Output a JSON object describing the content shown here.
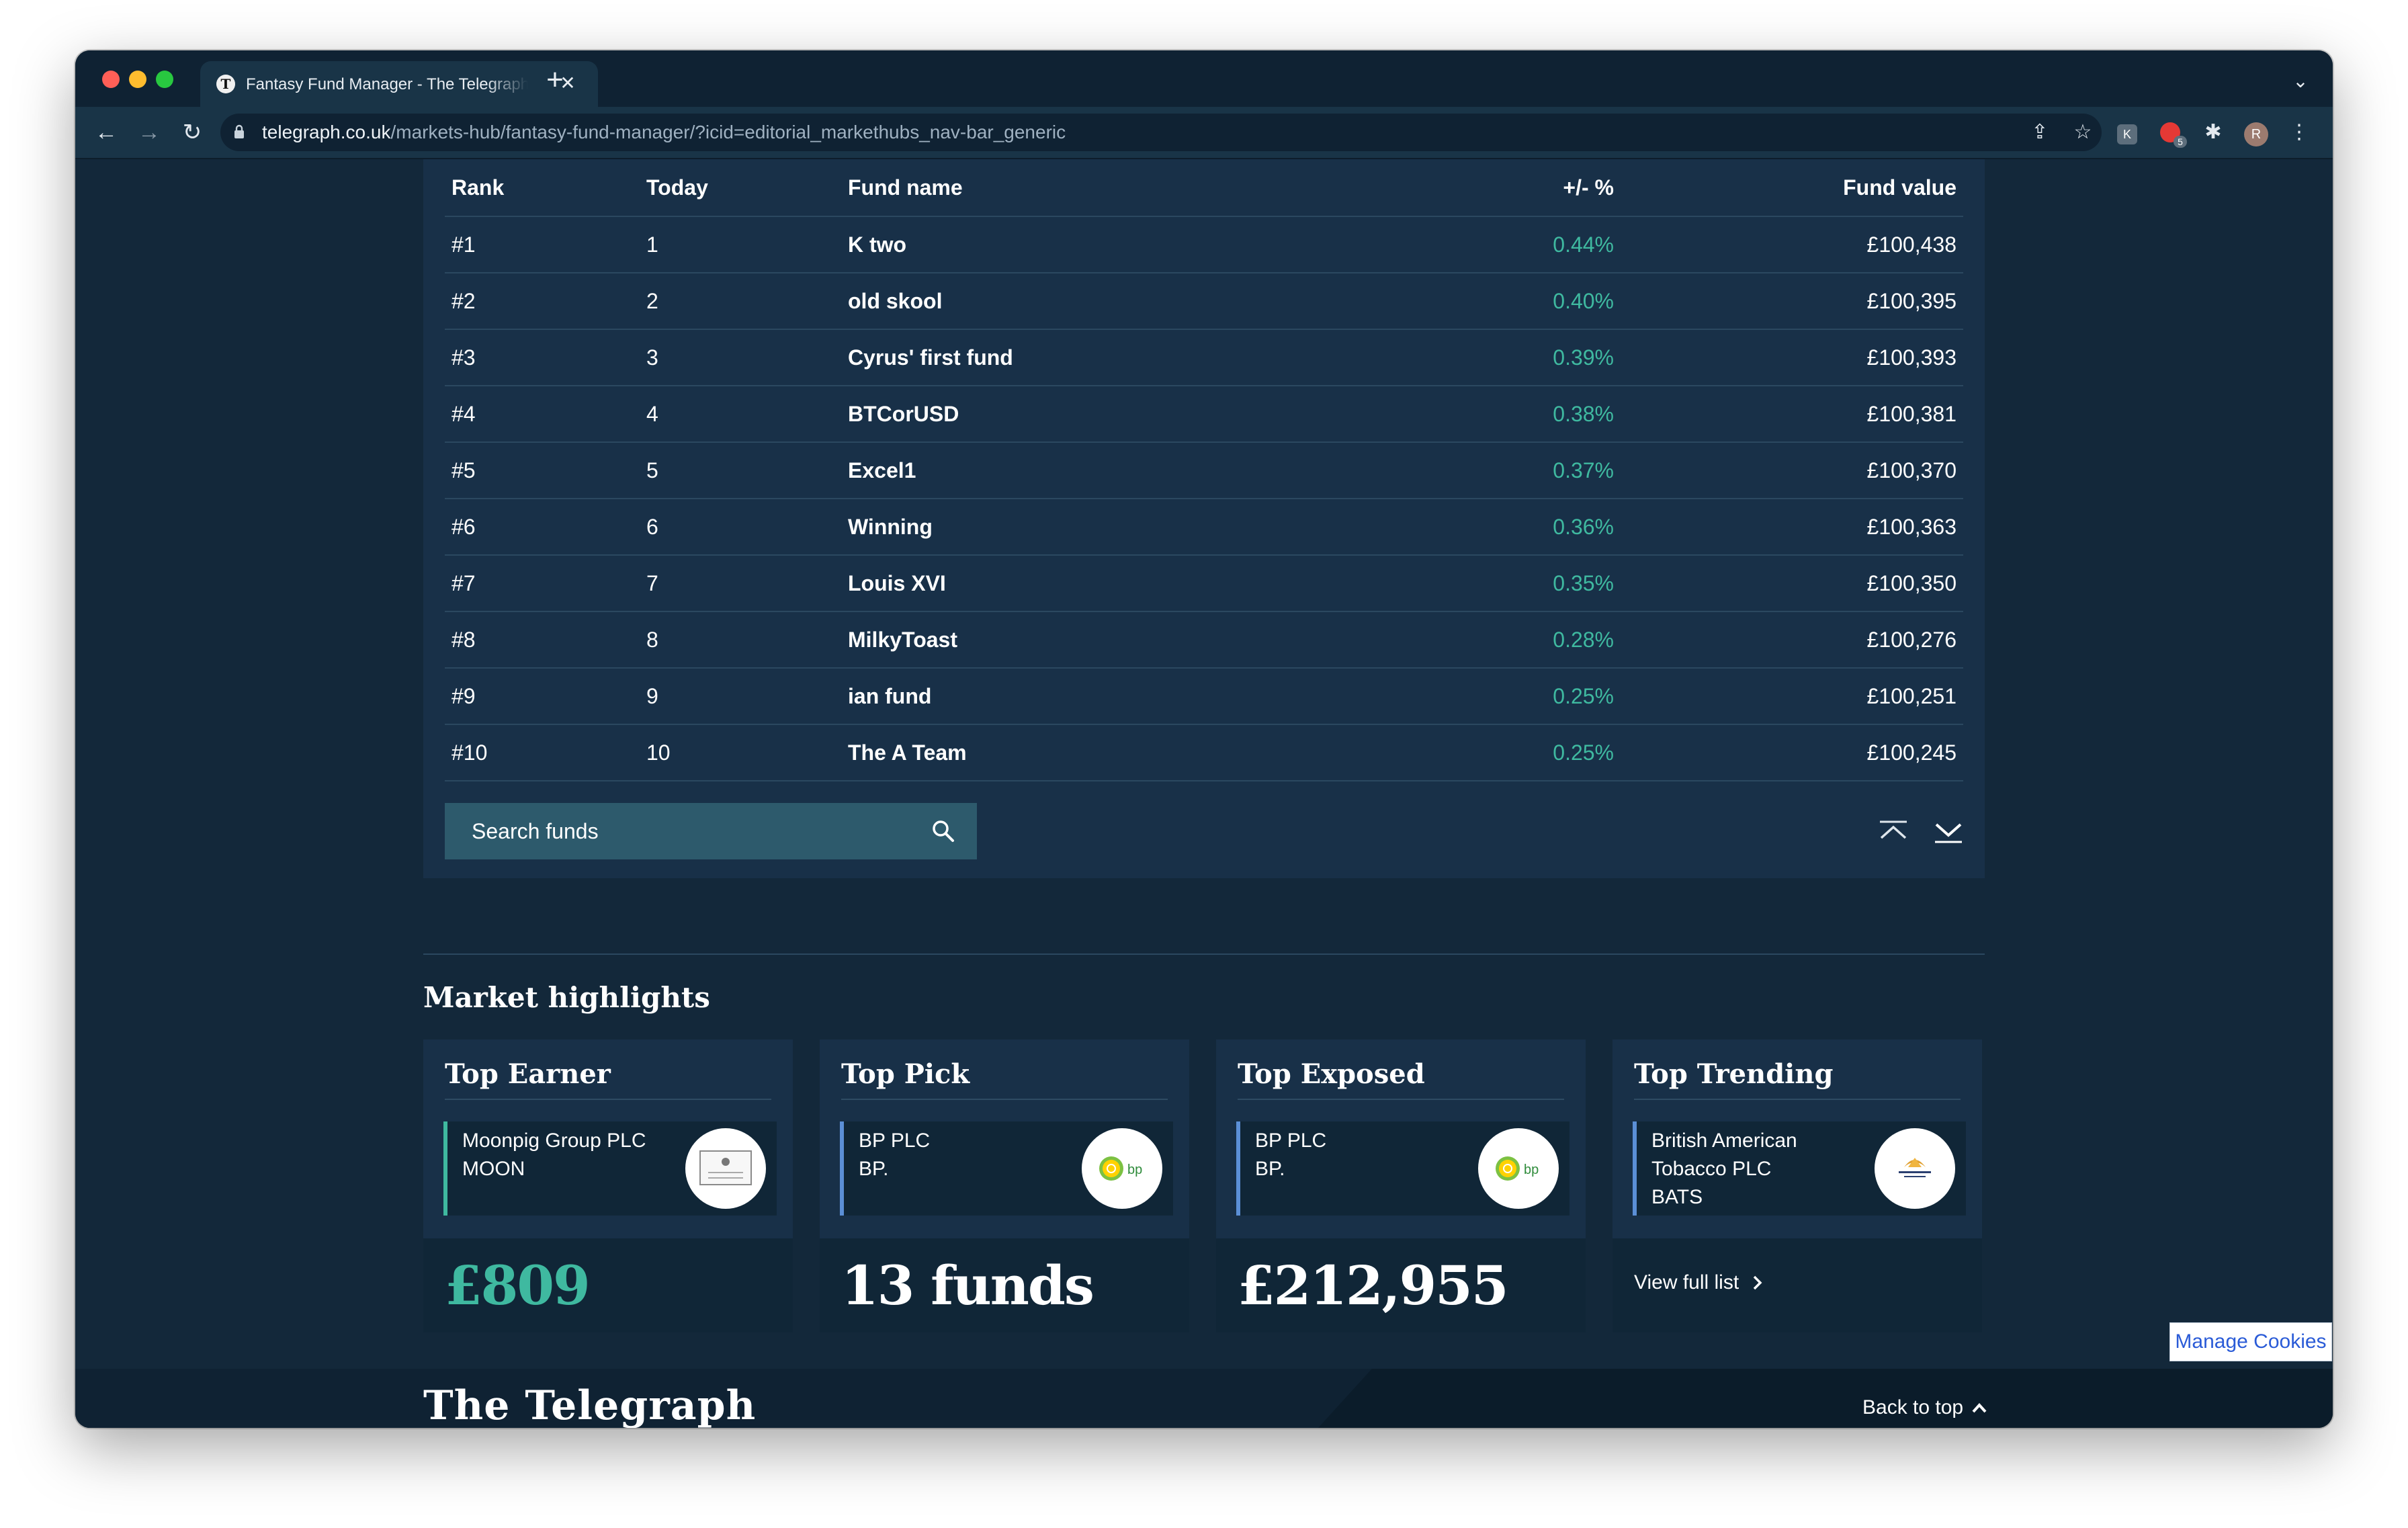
{
  "browser": {
    "tab_title": "Fantasy Fund Manager - The Telegraph",
    "url_host": "telegraph.co.uk",
    "url_path": "/markets-hub/fantasy-fund-manager/?icid=editorial_markethubs_nav-bar_generic",
    "extension_badge": "5",
    "profile_initial": "R",
    "extension_label": "K"
  },
  "leaderboard": {
    "headers": {
      "rank": "Rank",
      "today": "Today",
      "name": "Fund name",
      "change": "+/- %",
      "value": "Fund value"
    },
    "rows": [
      {
        "rank": "#1",
        "today": "1",
        "name": "K two",
        "change": "0.44%",
        "value": "£100,438"
      },
      {
        "rank": "#2",
        "today": "2",
        "name": "old skool",
        "change": "0.40%",
        "value": "£100,395"
      },
      {
        "rank": "#3",
        "today": "3",
        "name": "Cyrus' first fund",
        "change": "0.39%",
        "value": "£100,393"
      },
      {
        "rank": "#4",
        "today": "4",
        "name": "BTCorUSD",
        "change": "0.38%",
        "value": "£100,381"
      },
      {
        "rank": "#5",
        "today": "5",
        "name": "Excel1",
        "change": "0.37%",
        "value": "£100,370"
      },
      {
        "rank": "#6",
        "today": "6",
        "name": "Winning",
        "change": "0.36%",
        "value": "£100,363"
      },
      {
        "rank": "#7",
        "today": "7",
        "name": "Louis XVI",
        "change": "0.35%",
        "value": "£100,350"
      },
      {
        "rank": "#8",
        "today": "8",
        "name": "MilkyToast",
        "change": "0.28%",
        "value": "£100,276"
      },
      {
        "rank": "#9",
        "today": "9",
        "name": "ian fund",
        "change": "0.25%",
        "value": "£100,251"
      },
      {
        "rank": "#10",
        "today": "10",
        "name": "The A Team",
        "change": "0.25%",
        "value": "£100,245"
      }
    ],
    "search_placeholder": "Search funds"
  },
  "highlights": {
    "title": "Market highlights",
    "cards": [
      {
        "title": "Top Earner",
        "company": "Moonpig Group PLC",
        "ticker": "MOON",
        "value": "£809"
      },
      {
        "title": "Top Pick",
        "company": "BP PLC",
        "ticker": "BP.",
        "value": "13 funds"
      },
      {
        "title": "Top Exposed",
        "company": "BP PLC",
        "ticker": "BP.",
        "value": "£212,955"
      },
      {
        "title": "Top Trending",
        "company": "British American Tobacco PLC",
        "ticker": "BATS",
        "link": "View full list"
      }
    ]
  },
  "footer": {
    "logo": "The Telegraph",
    "back_to_top": "Back to top"
  },
  "cookies_button": "Manage Cookies",
  "colors": {
    "page_bg": "#13283a",
    "panel_bg": "#183048",
    "positive": "#3fb9a0",
    "accent_blue": "#5b8fd6",
    "search_bg": "#2d5a6c",
    "link": "#2a5bd7"
  },
  "icons": [
    "back-icon",
    "forward-icon",
    "reload-icon",
    "lock-icon",
    "share-icon",
    "star-icon",
    "extensions-icon",
    "menu-icon",
    "search-icon",
    "first-page-icon",
    "next-page-icon",
    "chevron-right-icon",
    "chevron-up-icon"
  ]
}
